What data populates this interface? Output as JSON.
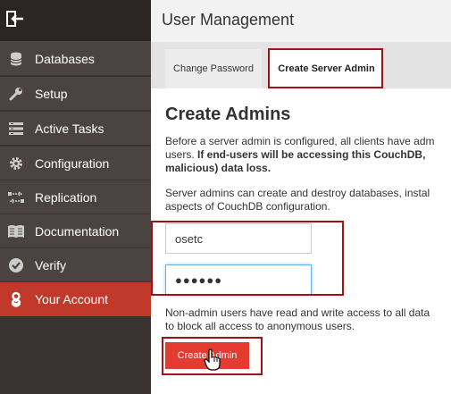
{
  "sidebar": {
    "items": [
      {
        "label": "Databases",
        "icon": "database-icon"
      },
      {
        "label": "Setup",
        "icon": "wrench-icon"
      },
      {
        "label": "Active Tasks",
        "icon": "tasks-icon"
      },
      {
        "label": "Configuration",
        "icon": "gear-icon"
      },
      {
        "label": "Replication",
        "icon": "replication-icon"
      },
      {
        "label": "Documentation",
        "icon": "book-icon"
      },
      {
        "label": "Verify",
        "icon": "check-circle-icon"
      },
      {
        "label": "Your Account",
        "icon": "user-icon"
      }
    ],
    "active": "Your Account"
  },
  "header": {
    "title": "User Management"
  },
  "tabs": [
    {
      "label": "Change Password"
    },
    {
      "label": "Create Server Admin"
    }
  ],
  "main": {
    "section_title": "Create Admins",
    "para1_line1": "Before a server admin is configured, all clients have adm",
    "para1_line2_pre": "users. ",
    "para1_line2_bold": "If end-users will be accessing this CouchDB,",
    "para1_line3_bold": "malicious) data loss.",
    "para2_line1": "Server admins can create and destroy databases, instal",
    "para2_line2": "aspects of CouchDB configuration.",
    "username_value": "osetc",
    "password_mask": "●●●●●●",
    "para3_line1": "Non-admin users have read and write access to all data",
    "para3_line2": "to block all access to anonymous users.",
    "create_button": "Create Admin"
  },
  "colors": {
    "sidebar_bg": "#3a3332",
    "nav_item_bg": "#4a4342",
    "active_bg": "#c0392b",
    "button_bg": "#e33b2f",
    "highlight": "#a31212"
  }
}
